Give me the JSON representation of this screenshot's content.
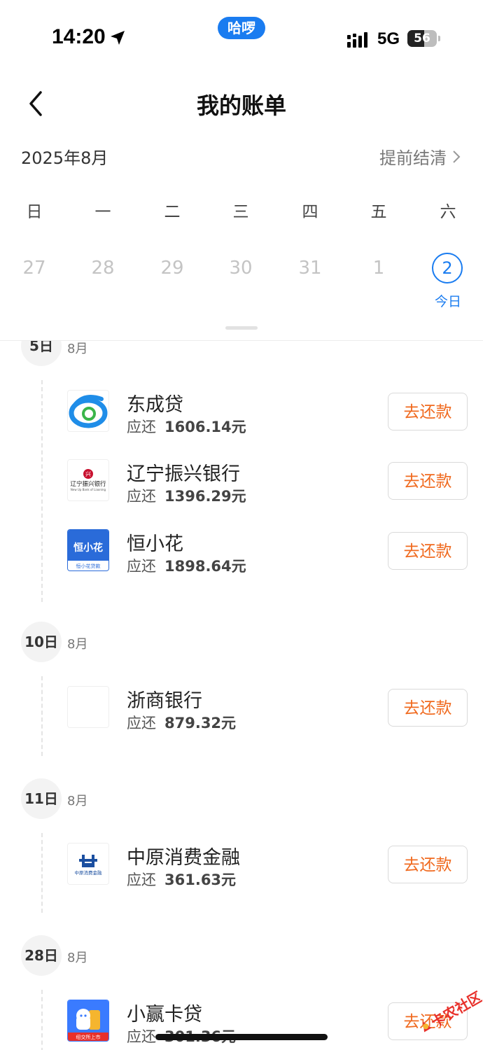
{
  "status": {
    "time": "14:20",
    "pill": "哈啰",
    "network": "5G",
    "battery": "56",
    "battery_level": 0.56
  },
  "header": {
    "title": "我的账单"
  },
  "calendar": {
    "month": "2025年8月",
    "settle_label": "提前结清",
    "weekdays": [
      "日",
      "一",
      "二",
      "三",
      "四",
      "五",
      "六"
    ],
    "dates": [
      "27",
      "28",
      "29",
      "30",
      "31",
      "1"
    ],
    "today_date": "2",
    "today_label": "今日"
  },
  "groups": [
    {
      "day": "5日",
      "month": "8月",
      "items": [
        {
          "name": "东成贷",
          "due_label": "应还",
          "amount": "1606.14元",
          "action": "去还款",
          "logo": "dongcheng-logo"
        },
        {
          "name": "辽宁振兴银行",
          "due_label": "应还",
          "amount": "1396.29元",
          "action": "去还款",
          "logo": "liaoning-zhenxing-logo",
          "logo_text": "辽宁振兴银行",
          "logo_sub": "New Up Bank of Liaoning"
        },
        {
          "name": "恒小花",
          "due_label": "应还",
          "amount": "1898.64元",
          "action": "去还款",
          "logo": "hengxiaohua-logo",
          "logo_text": "恒小花",
          "logo_sub": "恒小花贷款"
        }
      ]
    },
    {
      "day": "10日",
      "month": "8月",
      "items": [
        {
          "name": "浙商银行",
          "due_label": "应还",
          "amount": "879.32元",
          "action": "去还款",
          "logo": "zheshang-logo"
        }
      ]
    },
    {
      "day": "11日",
      "month": "8月",
      "items": [
        {
          "name": "中原消费金融",
          "due_label": "应还",
          "amount": "361.63元",
          "action": "去还款",
          "logo": "zhongyuan-logo",
          "logo_text": "中原消费金融"
        }
      ]
    },
    {
      "day": "28日",
      "month": "8月",
      "items": [
        {
          "name": "小赢卡贷",
          "due_label": "应还",
          "amount": "301.36元",
          "action": "去还款",
          "logo": "xiaoying-logo",
          "logo_text": "纽交所上市"
        }
      ]
    }
  ],
  "watermark": "卡农社区",
  "colors": {
    "accent": "#1a7cf0",
    "action": "#f06a1f"
  }
}
